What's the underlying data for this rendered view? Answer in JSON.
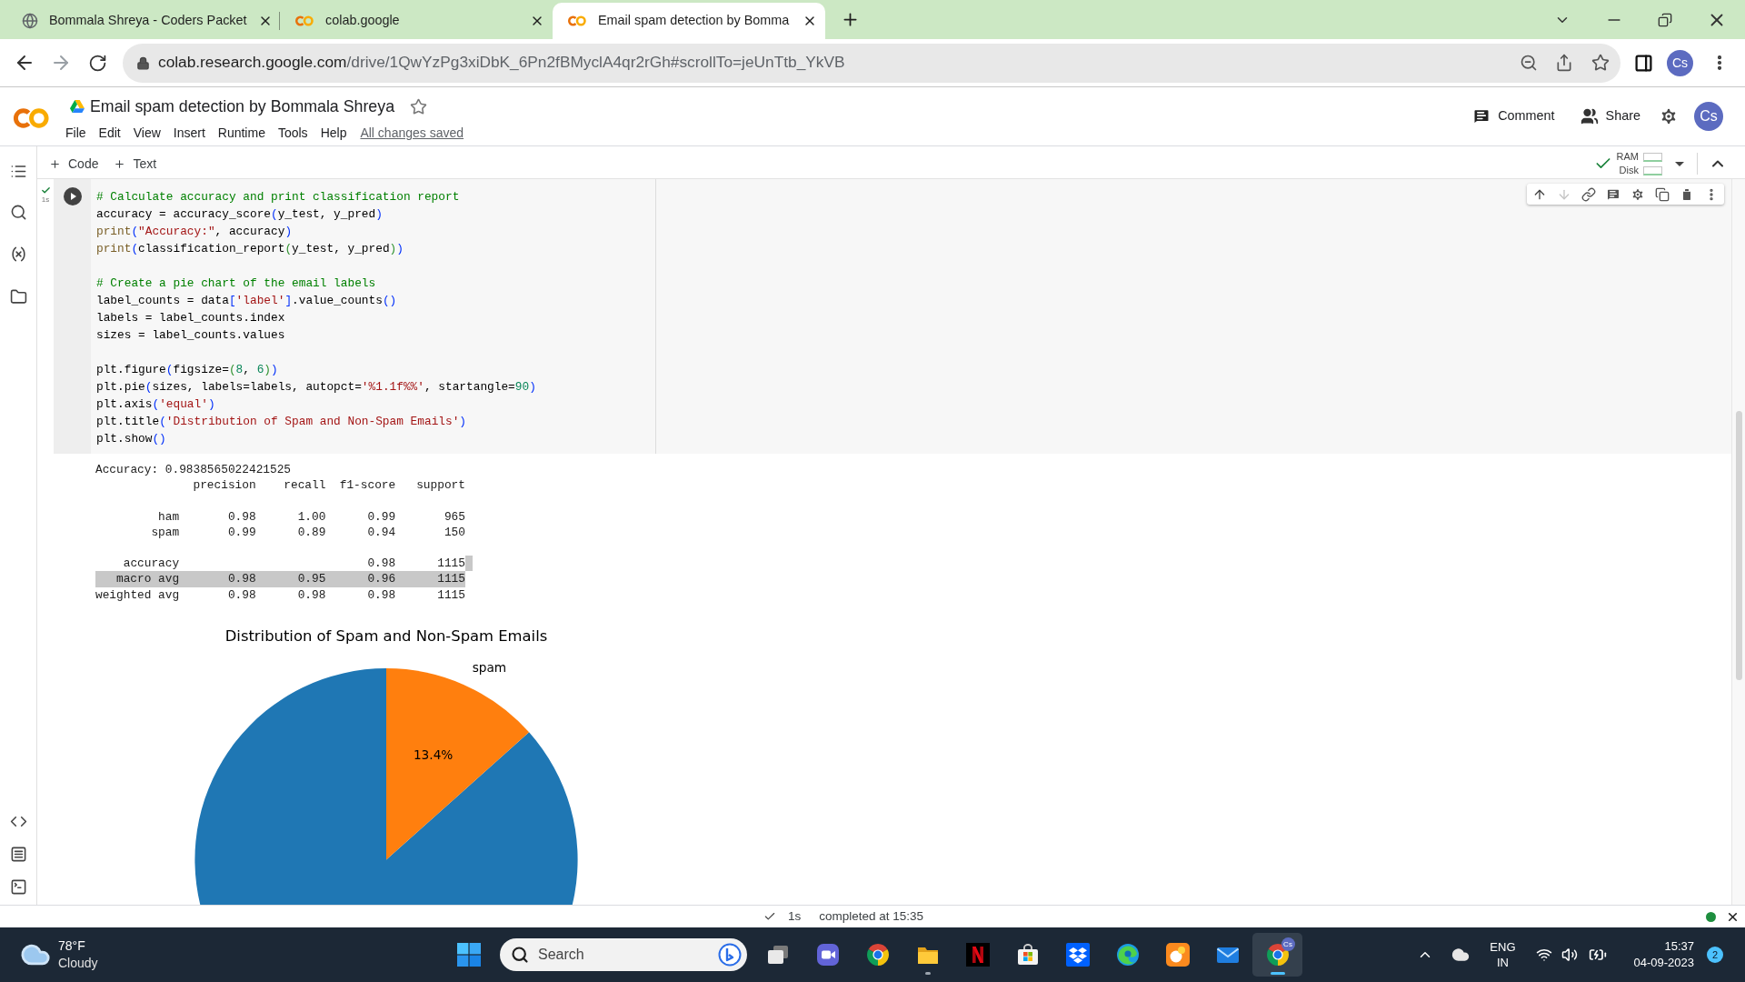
{
  "browser": {
    "tabs": [
      {
        "title": "Bommala Shreya - Coders Packet",
        "selected": false
      },
      {
        "title": "colab.google",
        "selected": false
      },
      {
        "title": "Email spam detection by Bomma",
        "selected": true
      }
    ],
    "url": {
      "host": "colab.research.google.com",
      "path": "/drive/1QwYzPg3xiDbK_6Pn2fBMyclA4qr2rGh#scrollTo=jeUnTtb_YkVB"
    },
    "profile": "Cs"
  },
  "notebook": {
    "title": "Email spam detection by Bommala Shreya",
    "menu": [
      "File",
      "Edit",
      "View",
      "Insert",
      "Runtime",
      "Tools",
      "Help"
    ],
    "save_status": "All changes saved",
    "comment": "Comment",
    "share": "Share",
    "avatar": "Cs"
  },
  "toolbar": {
    "add_buttons": [
      "Code",
      "Text"
    ],
    "resources": [
      "RAM",
      "Disk"
    ]
  },
  "cell": {
    "run_time": "1s",
    "code_blocks": [
      [
        [
          {
            "kind": "comment",
            "text": "# Calculate accuracy and print classification report"
          }
        ],
        [
          {
            "kind": "plain",
            "text": "accuracy = accuracy_score"
          },
          {
            "kind": "bracket1",
            "text": "("
          },
          {
            "kind": "plain",
            "text": "y_test, y_pred"
          },
          {
            "kind": "bracket1",
            "text": ")"
          }
        ],
        [
          {
            "kind": "builtin",
            "text": "print"
          },
          {
            "kind": "bracket1",
            "text": "("
          },
          {
            "kind": "string",
            "text": "\"Accuracy:\""
          },
          {
            "kind": "plain",
            "text": ", accuracy"
          },
          {
            "kind": "bracket1",
            "text": ")"
          }
        ],
        [
          {
            "kind": "builtin",
            "text": "print"
          },
          {
            "kind": "bracket1",
            "text": "("
          },
          {
            "kind": "plain",
            "text": "classification_report"
          },
          {
            "kind": "bracket2",
            "text": "("
          },
          {
            "kind": "plain",
            "text": "y_test, y_pred"
          },
          {
            "kind": "bracket2",
            "text": ")"
          },
          {
            "kind": "bracket1",
            "text": ")"
          }
        ]
      ],
      [
        [
          {
            "kind": "comment",
            "text": "# Create a pie chart of the email labels"
          }
        ],
        [
          {
            "kind": "plain",
            "text": "label_counts = data"
          },
          {
            "kind": "bracket1",
            "text": "["
          },
          {
            "kind": "string",
            "text": "'label'"
          },
          {
            "kind": "bracket1",
            "text": "]"
          },
          {
            "kind": "plain",
            "text": ".value_counts"
          },
          {
            "kind": "bracket1",
            "text": "()"
          }
        ],
        [
          {
            "kind": "plain",
            "text": "labels = label_counts.index"
          }
        ],
        [
          {
            "kind": "plain",
            "text": "sizes = label_counts.values"
          }
        ]
      ],
      [
        [
          {
            "kind": "plain",
            "text": "plt.figure"
          },
          {
            "kind": "bracket1",
            "text": "("
          },
          {
            "kind": "plain",
            "text": "figsize="
          },
          {
            "kind": "bracket2",
            "text": "("
          },
          {
            "kind": "number",
            "text": "8"
          },
          {
            "kind": "plain",
            "text": ", "
          },
          {
            "kind": "number",
            "text": "6"
          },
          {
            "kind": "bracket2",
            "text": ")"
          },
          {
            "kind": "bracket1",
            "text": ")"
          }
        ],
        [
          {
            "kind": "plain",
            "text": "plt.pie"
          },
          {
            "kind": "bracket1",
            "text": "("
          },
          {
            "kind": "plain",
            "text": "sizes, labels=labels, autopct="
          },
          {
            "kind": "string",
            "text": "'%1.1f%%'"
          },
          {
            "kind": "plain",
            "text": ", startangle="
          },
          {
            "kind": "number",
            "text": "90"
          },
          {
            "kind": "bracket1",
            "text": ")"
          }
        ],
        [
          {
            "kind": "plain",
            "text": "plt.axis"
          },
          {
            "kind": "bracket1",
            "text": "("
          },
          {
            "kind": "string",
            "text": "'equal'"
          },
          {
            "kind": "bracket1",
            "text": ")"
          }
        ],
        [
          {
            "kind": "plain",
            "text": "plt.title"
          },
          {
            "kind": "bracket1",
            "text": "("
          },
          {
            "kind": "string",
            "text": "'Distribution of Spam and Non-Spam Emails'"
          },
          {
            "kind": "bracket1",
            "text": ")"
          }
        ],
        [
          {
            "kind": "plain",
            "text": "plt.show"
          },
          {
            "kind": "bracket1",
            "text": "()"
          }
        ]
      ]
    ]
  },
  "output": {
    "accuracy_line": "Accuracy: 0.9838565022421525",
    "report": {
      "columns": [
        "precision",
        "recall",
        "f1-score",
        "support"
      ],
      "row_groups": [
        [
          {
            "label": "ham",
            "values": [
              "0.98",
              "1.00",
              "0.99",
              "965"
            ],
            "selected": false
          },
          {
            "label": "spam",
            "values": [
              "0.99",
              "0.89",
              "0.94",
              "150"
            ],
            "selected": false
          }
        ],
        [
          {
            "label": "accuracy",
            "values": [
              "0.98",
              "1115"
            ],
            "selected": false
          },
          {
            "label": "macro avg",
            "values": [
              "0.98",
              "0.95",
              "0.96",
              "1115"
            ],
            "selected": true
          },
          {
            "label": "weighted avg",
            "values": [
              "0.98",
              "0.98",
              "0.98",
              "1115"
            ],
            "selected": false
          }
        ]
      ]
    },
    "chart_data": {
      "type": "pie",
      "title": "Distribution of Spam and Non-Spam Emails",
      "categories": [
        null,
        "spam"
      ],
      "values": [
        86.6,
        13.4
      ],
      "colors": [
        "#1f77b4",
        "#ff7f0e"
      ],
      "value_labels": [
        null,
        "13.4%"
      ]
    }
  },
  "status_bar": {
    "run_time": "1s",
    "message": "completed at 15:35"
  },
  "taskbar": {
    "weather": {
      "temperature": "78°F",
      "condition": "Cloudy"
    },
    "search_placeholder": "Search",
    "apps": [
      {
        "kind": "task-view",
        "running": false,
        "selected": false
      },
      {
        "kind": "video-call",
        "running": false,
        "selected": false
      },
      {
        "kind": "browser",
        "running": false,
        "selected": false
      },
      {
        "kind": "folder",
        "running": true,
        "selected": false
      },
      {
        "kind": "ribbon",
        "running": false,
        "selected": false
      },
      {
        "kind": "store",
        "running": false,
        "selected": false
      },
      {
        "kind": "box",
        "running": false,
        "selected": false
      },
      {
        "kind": "swirl",
        "running": false,
        "selected": false
      },
      {
        "kind": "tile",
        "running": false,
        "selected": false
      },
      {
        "kind": "mail",
        "running": false,
        "selected": false
      },
      {
        "kind": "browser",
        "running": true,
        "selected": true,
        "badge": "Cs"
      }
    ],
    "language": [
      "ENG",
      "IN"
    ],
    "time": "15:37",
    "date": "04-09-2023",
    "notifications": "2"
  }
}
